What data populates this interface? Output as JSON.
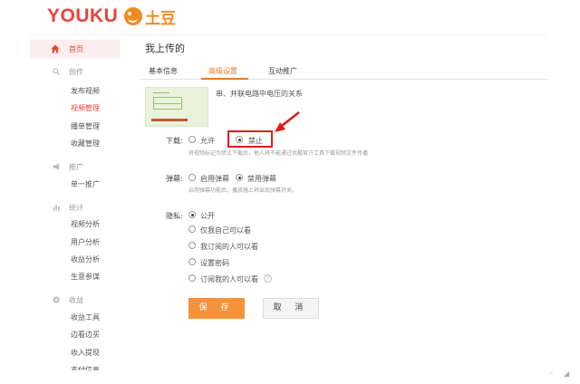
{
  "header": {
    "logo_youku": "YOUKU",
    "logo_tudou": "土豆"
  },
  "sidebar": {
    "home": "首页",
    "sections": [
      {
        "label": "创作",
        "icon": "search-icon",
        "items": [
          "发布视频",
          "视频管理",
          "播单管理",
          "收藏管理"
        ]
      },
      {
        "label": "推广",
        "icon": "megaphone-icon",
        "items": [
          "单一推广"
        ]
      },
      {
        "label": "统计",
        "icon": "bar-chart-icon",
        "items": [
          "视频分析",
          "用户分析",
          "收益分析",
          "生意参谋"
        ]
      },
      {
        "label": "收益",
        "icon": "coin-icon",
        "items": [
          "收益工具",
          "边看边买",
          "收入提现",
          "支付信息"
        ]
      }
    ],
    "active_item": "视频管理"
  },
  "main": {
    "title": "我上传的",
    "tabs": [
      "基本信息",
      "高级设置",
      "互动推广"
    ],
    "active_tab": "高级设置",
    "video_title": "串、并联电路中电压的关系",
    "download": {
      "label": "下载:",
      "options": [
        "允许",
        "禁止"
      ],
      "selected": "禁止",
      "hint": "将视频标记为禁止下载后，他人将不能通过优酷官方工具下载视频文件传播"
    },
    "danmaku": {
      "label": "弹幕:",
      "options": [
        "启用弹幕",
        "禁用弹幕"
      ],
      "selected": "禁用弹幕",
      "hint": "启用弹幕功能后，播放器上将出现弹幕开关。"
    },
    "privacy": {
      "label": "隐私:",
      "options": [
        "公开",
        "仅我自己可以看",
        "我订阅的人可以看",
        "设置密码",
        "订阅我的人可以看"
      ],
      "selected": "公开"
    },
    "save_button": "保 存",
    "cancel_button": "取 消"
  },
  "colors": {
    "brand_red": "#e8443a",
    "accent_orange": "#f07a1f",
    "annotation_red": "#e01b1b"
  }
}
